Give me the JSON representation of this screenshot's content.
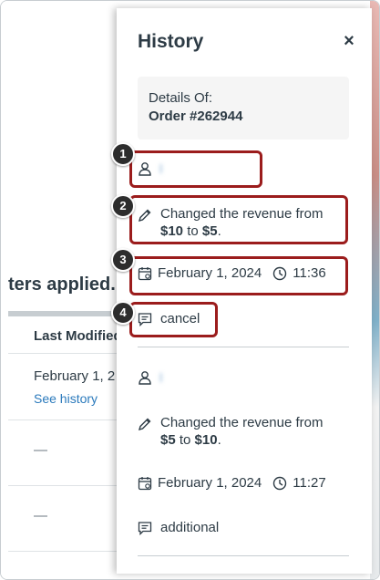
{
  "background": {
    "filters_text": "ters applied.",
    "column_header": "Last Modified",
    "row1_date": "February 1, 2",
    "row1_link": "See history",
    "row2_value": "—",
    "row3_value": "—"
  },
  "drawer": {
    "title": "History",
    "close_label": "×",
    "details": {
      "label": "Details Of:",
      "order": "Order #262944"
    },
    "entries": [
      {
        "user": "l",
        "change_prefix": "Changed the revenue from",
        "from_value": "$10",
        "connector": "to",
        "to_value": "$5",
        "suffix": ".",
        "date": "February 1, 2024",
        "time": "11:36",
        "comment": "cancel"
      },
      {
        "user": "l",
        "change_prefix": "Changed the revenue from",
        "from_value": "$5",
        "connector": "to",
        "to_value": "$10",
        "suffix": ".",
        "date": "February 1, 2024",
        "time": "11:27",
        "comment": "additional"
      }
    ]
  },
  "callouts": [
    "1",
    "2",
    "3",
    "4"
  ],
  "colors": {
    "callout_border": "#9b1c1c",
    "callout_badge": "#2d2d2d",
    "link": "#2b7abc"
  }
}
